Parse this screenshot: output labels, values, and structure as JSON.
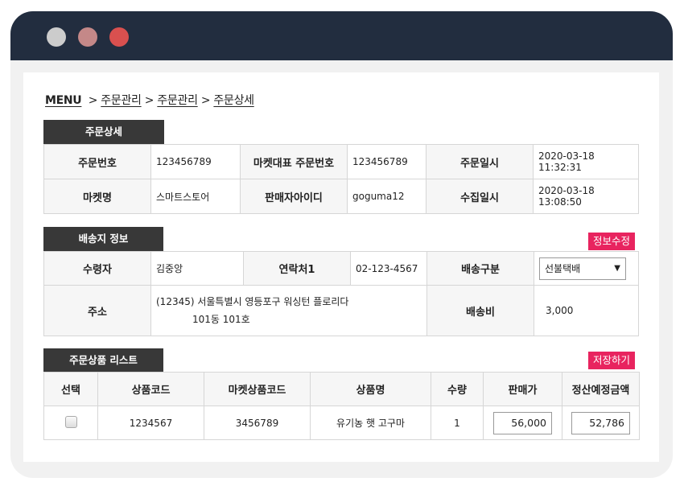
{
  "window": {
    "dots": [
      "#cccccc",
      "#c48888",
      "#d9504f"
    ]
  },
  "breadcrumb": {
    "menu": "MENU",
    "items": [
      "주문관리",
      "주문관리",
      "주문상세"
    ]
  },
  "order_detail": {
    "tab": "주문상세",
    "order_no_label": "주문번호",
    "order_no": "123456789",
    "market_order_no_label": "마켓대표 주문번호",
    "market_order_no": "123456789",
    "order_date_label": "주문일시",
    "order_date": "2020-03-18 11:32:31",
    "market_label": "마켓명",
    "market": "스마트스토어",
    "seller_id_label": "판매자아이디",
    "seller_id": "goguma12",
    "collect_date_label": "수집일시",
    "collect_date": "2020-03-18 13:08:50"
  },
  "shipping": {
    "tab": "배송지 정보",
    "edit_button": "정보수정",
    "receiver_label": "수령자",
    "receiver": "김중앙",
    "contact_label": "연락처1",
    "contact": "02-123-4567",
    "delivery_type_label": "배송구분",
    "delivery_type": "선불택배",
    "address_label": "주소",
    "address_line1": "(12345) 서울특별시 영등포구 워싱턴 플로리다",
    "address_line2": "101동 101호",
    "fee_label": "배송비",
    "fee": "3,000"
  },
  "products": {
    "tab": "주문상품 리스트",
    "save_button": "저장하기",
    "headers": {
      "select": "선택",
      "code": "상품코드",
      "market_code": "마켓상품코드",
      "name": "상품명",
      "qty": "수량",
      "price": "판매가",
      "settle": "정산예정금액"
    },
    "rows": [
      {
        "code": "1234567",
        "market_code": "3456789",
        "name": "유기농 햇 고구마",
        "qty": "1",
        "price": "56,000",
        "settle": "52,786",
        "checked": false
      }
    ]
  }
}
